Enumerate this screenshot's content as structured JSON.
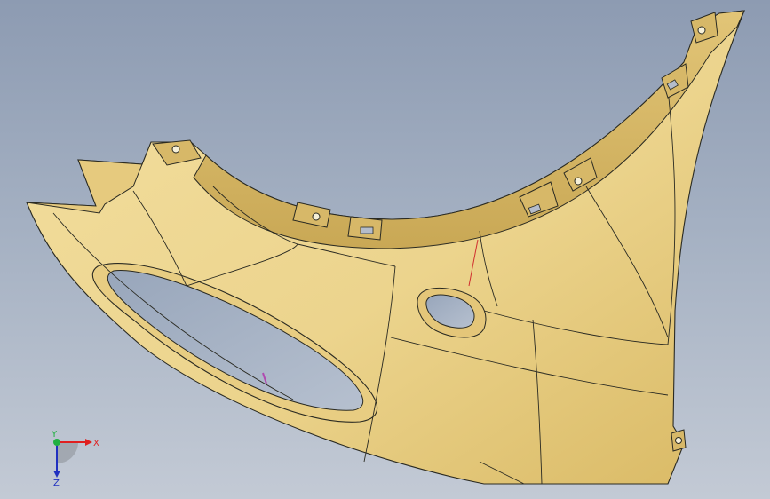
{
  "viewport": {
    "background_top": "#8d9bb2",
    "background_bottom": "#c3cad5"
  },
  "model": {
    "part": "fender-panel",
    "surface_color": "#ecd48d",
    "shade_color": "#d9b964",
    "edge_color": "#2a2a22"
  },
  "triad": {
    "x_label": "X",
    "y_label": "Y",
    "z_label": "Z",
    "x_color": "#e02020",
    "y_color": "#20b040",
    "z_color": "#2030c0"
  }
}
